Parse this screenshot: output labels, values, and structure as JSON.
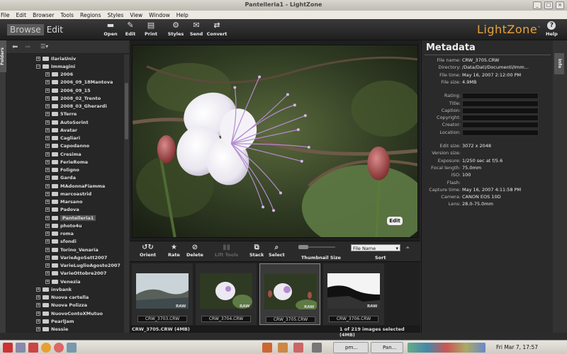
{
  "window": {
    "title": "Pantelleria1 - LightZone"
  },
  "menu": [
    "File",
    "Edit",
    "Browser",
    "Tools",
    "Regions",
    "Styles",
    "View",
    "Window",
    "Help"
  ],
  "mode": {
    "browse": "Browse",
    "edit": "Edit"
  },
  "toolbar": {
    "open": "Open",
    "edit": "Edit",
    "print": "Print",
    "styles": "Styles",
    "send": "Send",
    "convert": "Convert",
    "help": "Help"
  },
  "logo": "LightZone",
  "left_tab": "Folders",
  "right_tab": "Info",
  "tree": [
    {
      "label": "IlariaUniv",
      "depth": 1
    },
    {
      "label": "Immagini",
      "depth": 1
    },
    {
      "label": "2006",
      "depth": 2
    },
    {
      "label": "2006_09_18Mantova",
      "depth": 2
    },
    {
      "label": "2006_09_15",
      "depth": 2
    },
    {
      "label": "2008_02_Trento",
      "depth": 2
    },
    {
      "label": "2008_03_Gherardi",
      "depth": 2
    },
    {
      "label": "5Terre",
      "depth": 2
    },
    {
      "label": "AutoSorint",
      "depth": 2
    },
    {
      "label": "Avatar",
      "depth": 2
    },
    {
      "label": "Cagliari",
      "depth": 2
    },
    {
      "label": "Capodanno",
      "depth": 2
    },
    {
      "label": "Cresima",
      "depth": 2
    },
    {
      "label": "FerieRoma",
      "depth": 2
    },
    {
      "label": "Foligno",
      "depth": 2
    },
    {
      "label": "Garda",
      "depth": 2
    },
    {
      "label": "MAdonnaFiamma",
      "depth": 2
    },
    {
      "label": "marcoastrid",
      "depth": 2
    },
    {
      "label": "Marsano",
      "depth": 2
    },
    {
      "label": "Padova",
      "depth": 2
    },
    {
      "label": "Pantelleria1",
      "depth": 2
    },
    {
      "label": "photo4u",
      "depth": 2
    },
    {
      "label": "roma",
      "depth": 2
    },
    {
      "label": "sfondi",
      "depth": 2
    },
    {
      "label": "Torino_Venaria",
      "depth": 2
    },
    {
      "label": "VarieAgoSett2007",
      "depth": 2
    },
    {
      "label": "VarieLuglioAgosto2007",
      "depth": 2
    },
    {
      "label": "VarieOttobre2007",
      "depth": 2
    },
    {
      "label": "Venezia",
      "depth": 2
    },
    {
      "label": "invbank",
      "depth": 1
    },
    {
      "label": "Nuova cartella",
      "depth": 1
    },
    {
      "label": "Nuova Polizza",
      "depth": 1
    },
    {
      "label": "NuovoContoXMutuo",
      "depth": 1
    },
    {
      "label": "PearlJam",
      "depth": 1
    },
    {
      "label": "Nessie",
      "depth": 1
    }
  ],
  "selected_folder": "Pantelleria1",
  "photo_badge": "Edit",
  "browser_tools": {
    "orient": "Orient",
    "rate": "Rate",
    "delete": "Delete",
    "lift": "Lift Tools",
    "stack": "Stack",
    "select": "Select",
    "thumb_size": "Thumbnail Size",
    "sort": "Sort",
    "sort_value": "File Name"
  },
  "thumbnails": [
    {
      "name": "CRW_3703.CRW",
      "badge": "RAW"
    },
    {
      "name": "CRW_3704.CRW",
      "badge": "RAW"
    },
    {
      "name": "CRW_3705.CRW",
      "badge": "RAW"
    },
    {
      "name": "CRW_3706.CRW",
      "badge": "RAW"
    }
  ],
  "status": {
    "left": "CRW_3705.CRW (4MB)",
    "right": "1 of 219 images selected (4MB)"
  },
  "metadata": {
    "heading": "Metadata",
    "file_rows": [
      {
        "k": "File name:",
        "v": "CRW_3705.CRW"
      },
      {
        "k": "Directory:",
        "v": "/Data/Dati/Documenti/Imm..."
      },
      {
        "k": "File time:",
        "v": "May 16, 2007 2:12:00 PM"
      },
      {
        "k": "File size:",
        "v": "4.9MB"
      }
    ],
    "edit_rows": [
      "Rating:",
      "Title:",
      "Caption:",
      "Copyright:",
      "Creator:",
      "Location:"
    ],
    "exif_rows": [
      {
        "k": "Edit size:",
        "v": "3072 x 2048"
      },
      {
        "k": "Version size:",
        "v": ""
      },
      {
        "k": "Exposure:",
        "v": "1/250 sec at f/5.6"
      },
      {
        "k": "Focal length:",
        "v": "75.0mm"
      },
      {
        "k": "ISO:",
        "v": "100"
      },
      {
        "k": "Flash:",
        "v": ""
      },
      {
        "k": "Capture time:",
        "v": "May 16, 2007 4:11:58 PM"
      },
      {
        "k": "Camera:",
        "v": "CANON EOS 10D"
      },
      {
        "k": "Lens:",
        "v": "28.0-75.0mm"
      }
    ]
  },
  "taskbar": {
    "win1": "pm...",
    "win2": "Pan...",
    "clock": "Fri Mar  7, 17:57"
  }
}
